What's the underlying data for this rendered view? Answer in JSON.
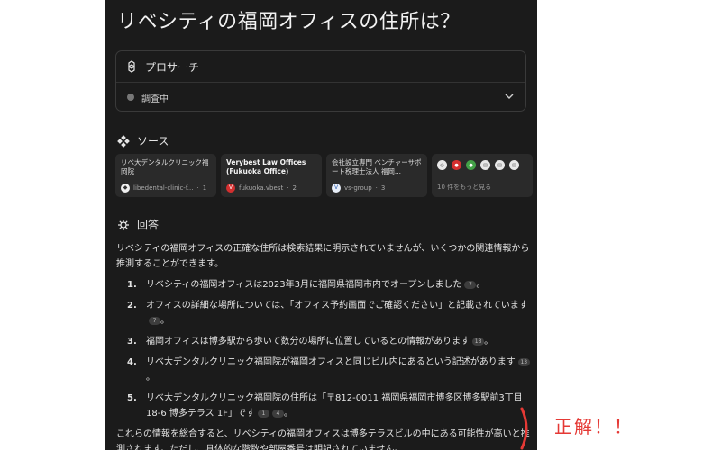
{
  "query": {
    "title": "リベシティの福岡オフィスの住所は？"
  },
  "pro_search": {
    "label": "プロサーチ",
    "status": "調査中"
  },
  "sources": {
    "heading": "ソース",
    "cards": [
      {
        "title": "リベ大デンタルクリニック福岡院",
        "site": "libedental-clinic-f...",
        "index": "1"
      },
      {
        "title": "Verybest Law Offices (Fukuoka Office)",
        "site": "fukuoka.vbest",
        "index": "2"
      },
      {
        "title": "会社設立専門 ベンチャーサポート税理士法人 福岡...",
        "site": "vs-group",
        "index": "3"
      }
    ],
    "more_label": "10 件をもっと見る"
  },
  "answer": {
    "heading": "回答",
    "intro": "リベシティの福岡オフィスの正確な住所は検索結果に明示されていませんが、いくつかの関連情報から推測することができます。",
    "items": [
      {
        "num": "1.",
        "text": "リベシティの福岡オフィスは2023年3月に福岡県福岡市内でオープンしました",
        "cites": [
          "7"
        ],
        "end": "。"
      },
      {
        "num": "2.",
        "text": "オフィスの詳細な場所については、「オフィス予約画面でご確認ください」と記載されています",
        "cites": [
          "7"
        ],
        "end": "。"
      },
      {
        "num": "3.",
        "text": "福岡オフィスは博多駅から歩いて数分の場所に位置しているとの情報があります",
        "cites": [
          "13"
        ],
        "end": "。"
      },
      {
        "num": "4.",
        "text": "リベ大デンタルクリニック福岡院が福岡オフィスと同じビル内にあるという記述があります",
        "cites": [
          "13"
        ],
        "end": "。"
      },
      {
        "num": "5.",
        "text": "リベ大デンタルクリニック福岡院の住所は「〒812-0011 福岡県福岡市博多区博多駅前3丁目18-6 博多テラス 1F」です",
        "cites": [
          "1",
          "4"
        ],
        "end": "。"
      }
    ],
    "conclusion": "これらの情報を総合すると、リベシティの福岡オフィスは博多テラスビルの中にある可能性が高いと推測されます。ただし、具体的な階数や部屋番号は明記されていません。"
  },
  "annotation": {
    "text": "正解！！",
    "color": "#e53935"
  }
}
